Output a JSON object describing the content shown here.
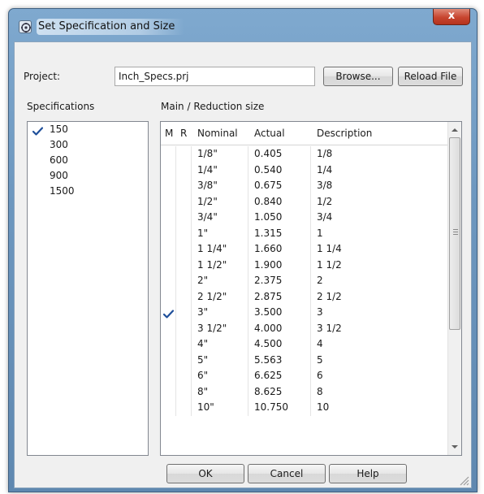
{
  "window": {
    "title": "Set Specification and Size",
    "close_label": "x"
  },
  "project": {
    "label": "Project:",
    "value": "Inch_Specs.prj",
    "browse_label": "Browse...",
    "reload_label": "Reload File"
  },
  "specifications": {
    "header": "Specifications",
    "items": [
      {
        "label": "150",
        "checked": true
      },
      {
        "label": "300",
        "checked": false
      },
      {
        "label": "600",
        "checked": false
      },
      {
        "label": "900",
        "checked": false
      },
      {
        "label": "1500",
        "checked": false
      }
    ]
  },
  "sizes": {
    "header": "Main / Reduction size",
    "columns": [
      "M",
      "R",
      "Nominal",
      "Actual",
      "Description"
    ],
    "rows": [
      {
        "m": false,
        "r": false,
        "nominal": "1/8\"",
        "actual": "0.405",
        "description": "1/8"
      },
      {
        "m": false,
        "r": false,
        "nominal": "1/4\"",
        "actual": "0.540",
        "description": "1/4"
      },
      {
        "m": false,
        "r": false,
        "nominal": "3/8\"",
        "actual": "0.675",
        "description": "3/8"
      },
      {
        "m": false,
        "r": false,
        "nominal": "1/2\"",
        "actual": "0.840",
        "description": "1/2"
      },
      {
        "m": false,
        "r": false,
        "nominal": "3/4\"",
        "actual": "1.050",
        "description": "3/4"
      },
      {
        "m": false,
        "r": false,
        "nominal": "1\"",
        "actual": "1.315",
        "description": "1"
      },
      {
        "m": false,
        "r": false,
        "nominal": "1 1/4\"",
        "actual": "1.660",
        "description": "1 1/4"
      },
      {
        "m": false,
        "r": false,
        "nominal": "1 1/2\"",
        "actual": "1.900",
        "description": "1 1/2"
      },
      {
        "m": false,
        "r": false,
        "nominal": "2\"",
        "actual": "2.375",
        "description": "2"
      },
      {
        "m": false,
        "r": false,
        "nominal": "2 1/2\"",
        "actual": "2.875",
        "description": "2 1/2"
      },
      {
        "m": true,
        "r": false,
        "nominal": "3\"",
        "actual": "3.500",
        "description": "3"
      },
      {
        "m": false,
        "r": false,
        "nominal": "3 1/2\"",
        "actual": "4.000",
        "description": "3 1/2"
      },
      {
        "m": false,
        "r": false,
        "nominal": "4\"",
        "actual": "4.500",
        "description": "4"
      },
      {
        "m": false,
        "r": false,
        "nominal": "5\"",
        "actual": "5.563",
        "description": "5"
      },
      {
        "m": false,
        "r": false,
        "nominal": "6\"",
        "actual": "6.625",
        "description": "6"
      },
      {
        "m": false,
        "r": false,
        "nominal": "8\"",
        "actual": "8.625",
        "description": "8"
      },
      {
        "m": false,
        "r": false,
        "nominal": "10\"",
        "actual": "10.750",
        "description": "10"
      }
    ]
  },
  "buttons": {
    "ok": "OK",
    "cancel": "Cancel",
    "help": "Help"
  },
  "colors": {
    "check": "#1f4f9a",
    "title_gradient": "#6d97bf",
    "close": "#c7452f"
  }
}
